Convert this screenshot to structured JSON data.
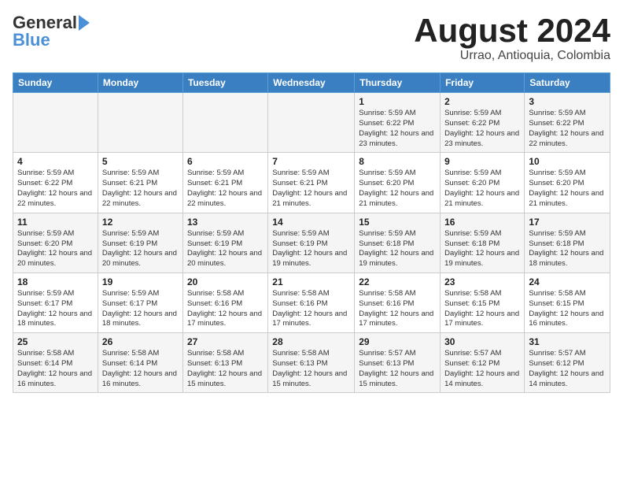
{
  "header": {
    "logo_line1": "General",
    "logo_line2": "Blue",
    "month_year": "August 2024",
    "location": "Urrao, Antioquia, Colombia"
  },
  "weekdays": [
    "Sunday",
    "Monday",
    "Tuesday",
    "Wednesday",
    "Thursday",
    "Friday",
    "Saturday"
  ],
  "weeks": [
    [
      {
        "day": "",
        "info": ""
      },
      {
        "day": "",
        "info": ""
      },
      {
        "day": "",
        "info": ""
      },
      {
        "day": "",
        "info": ""
      },
      {
        "day": "1",
        "info": "Sunrise: 5:59 AM\nSunset: 6:22 PM\nDaylight: 12 hours\nand 23 minutes."
      },
      {
        "day": "2",
        "info": "Sunrise: 5:59 AM\nSunset: 6:22 PM\nDaylight: 12 hours\nand 23 minutes."
      },
      {
        "day": "3",
        "info": "Sunrise: 5:59 AM\nSunset: 6:22 PM\nDaylight: 12 hours\nand 22 minutes."
      }
    ],
    [
      {
        "day": "4",
        "info": "Sunrise: 5:59 AM\nSunset: 6:22 PM\nDaylight: 12 hours\nand 22 minutes."
      },
      {
        "day": "5",
        "info": "Sunrise: 5:59 AM\nSunset: 6:21 PM\nDaylight: 12 hours\nand 22 minutes."
      },
      {
        "day": "6",
        "info": "Sunrise: 5:59 AM\nSunset: 6:21 PM\nDaylight: 12 hours\nand 22 minutes."
      },
      {
        "day": "7",
        "info": "Sunrise: 5:59 AM\nSunset: 6:21 PM\nDaylight: 12 hours\nand 21 minutes."
      },
      {
        "day": "8",
        "info": "Sunrise: 5:59 AM\nSunset: 6:20 PM\nDaylight: 12 hours\nand 21 minutes."
      },
      {
        "day": "9",
        "info": "Sunrise: 5:59 AM\nSunset: 6:20 PM\nDaylight: 12 hours\nand 21 minutes."
      },
      {
        "day": "10",
        "info": "Sunrise: 5:59 AM\nSunset: 6:20 PM\nDaylight: 12 hours\nand 21 minutes."
      }
    ],
    [
      {
        "day": "11",
        "info": "Sunrise: 5:59 AM\nSunset: 6:20 PM\nDaylight: 12 hours\nand 20 minutes."
      },
      {
        "day": "12",
        "info": "Sunrise: 5:59 AM\nSunset: 6:19 PM\nDaylight: 12 hours\nand 20 minutes."
      },
      {
        "day": "13",
        "info": "Sunrise: 5:59 AM\nSunset: 6:19 PM\nDaylight: 12 hours\nand 20 minutes."
      },
      {
        "day": "14",
        "info": "Sunrise: 5:59 AM\nSunset: 6:19 PM\nDaylight: 12 hours\nand 19 minutes."
      },
      {
        "day": "15",
        "info": "Sunrise: 5:59 AM\nSunset: 6:18 PM\nDaylight: 12 hours\nand 19 minutes."
      },
      {
        "day": "16",
        "info": "Sunrise: 5:59 AM\nSunset: 6:18 PM\nDaylight: 12 hours\nand 19 minutes."
      },
      {
        "day": "17",
        "info": "Sunrise: 5:59 AM\nSunset: 6:18 PM\nDaylight: 12 hours\nand 18 minutes."
      }
    ],
    [
      {
        "day": "18",
        "info": "Sunrise: 5:59 AM\nSunset: 6:17 PM\nDaylight: 12 hours\nand 18 minutes."
      },
      {
        "day": "19",
        "info": "Sunrise: 5:59 AM\nSunset: 6:17 PM\nDaylight: 12 hours\nand 18 minutes."
      },
      {
        "day": "20",
        "info": "Sunrise: 5:58 AM\nSunset: 6:16 PM\nDaylight: 12 hours\nand 17 minutes."
      },
      {
        "day": "21",
        "info": "Sunrise: 5:58 AM\nSunset: 6:16 PM\nDaylight: 12 hours\nand 17 minutes."
      },
      {
        "day": "22",
        "info": "Sunrise: 5:58 AM\nSunset: 6:16 PM\nDaylight: 12 hours\nand 17 minutes."
      },
      {
        "day": "23",
        "info": "Sunrise: 5:58 AM\nSunset: 6:15 PM\nDaylight: 12 hours\nand 17 minutes."
      },
      {
        "day": "24",
        "info": "Sunrise: 5:58 AM\nSunset: 6:15 PM\nDaylight: 12 hours\nand 16 minutes."
      }
    ],
    [
      {
        "day": "25",
        "info": "Sunrise: 5:58 AM\nSunset: 6:14 PM\nDaylight: 12 hours\nand 16 minutes."
      },
      {
        "day": "26",
        "info": "Sunrise: 5:58 AM\nSunset: 6:14 PM\nDaylight: 12 hours\nand 16 minutes."
      },
      {
        "day": "27",
        "info": "Sunrise: 5:58 AM\nSunset: 6:13 PM\nDaylight: 12 hours\nand 15 minutes."
      },
      {
        "day": "28",
        "info": "Sunrise: 5:58 AM\nSunset: 6:13 PM\nDaylight: 12 hours\nand 15 minutes."
      },
      {
        "day": "29",
        "info": "Sunrise: 5:57 AM\nSunset: 6:13 PM\nDaylight: 12 hours\nand 15 minutes."
      },
      {
        "day": "30",
        "info": "Sunrise: 5:57 AM\nSunset: 6:12 PM\nDaylight: 12 hours\nand 14 minutes."
      },
      {
        "day": "31",
        "info": "Sunrise: 5:57 AM\nSunset: 6:12 PM\nDaylight: 12 hours\nand 14 minutes."
      }
    ]
  ]
}
